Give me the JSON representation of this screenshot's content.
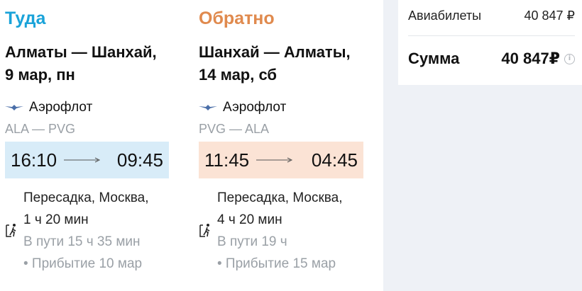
{
  "outbound": {
    "title": "Туда",
    "route": "Алматы — Шанхай,",
    "date": "9 мар, пн",
    "airline": "Аэрофлот",
    "codes": "ALA — PVG",
    "depart": "16:10",
    "arrive": "09:45",
    "layover_place": "Пересадка, Москва,",
    "layover_duration": "1 ч 20 мин",
    "travel_time": "В пути 15 ч 35 мин",
    "arrival_note": "• Прибытие 10 мар"
  },
  "return": {
    "title": "Обратно",
    "route": "Шанхай — Алматы,",
    "date": "14 мар, сб",
    "airline": "Аэрофлот",
    "codes": "PVG — ALA",
    "depart": "11:45",
    "arrive": "04:45",
    "layover_place": "Пересадка, Москва,",
    "layover_duration": "4 ч 20 мин",
    "travel_time": "В пути 19 ч",
    "arrival_note": "• Прибытие 15 мар"
  },
  "summary": {
    "tickets_label": "Авиабилеты",
    "tickets_value": "40 847 ₽",
    "total_label": "Сумма",
    "total_value": "40 847₽",
    "info_icon": "info-icon"
  },
  "colors": {
    "outbound_accent": "#1aa3d9",
    "return_accent": "#e08a4e",
    "outbound_time_bg": "#d8ecf8",
    "return_time_bg": "#fbe3d5"
  }
}
